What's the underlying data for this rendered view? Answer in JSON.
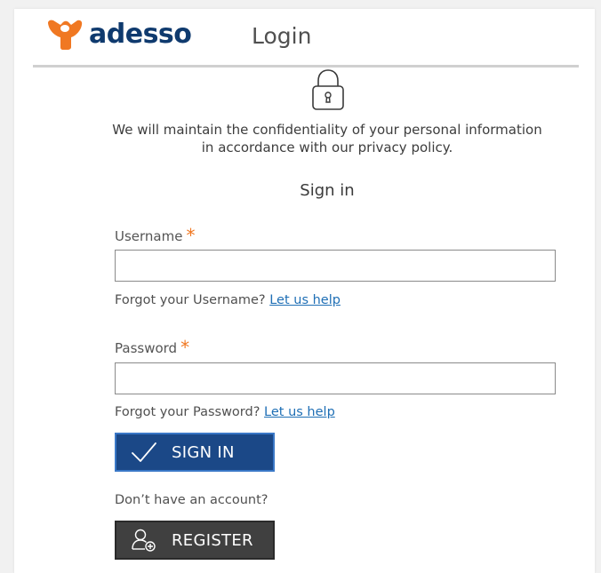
{
  "header": {
    "brand": "adesso",
    "title": "Login"
  },
  "icons": {
    "logo": "adesso-logo-icon",
    "lock": "lock-icon",
    "signin": "checkmark-icon",
    "register": "user-add-icon"
  },
  "privacy_notice": "We will maintain the confidentiality of your personal information in accordance with our privacy policy.",
  "form": {
    "heading": "Sign in",
    "username": {
      "label": "Username",
      "required_mark": "*",
      "value": "",
      "placeholder": ""
    },
    "username_help": {
      "text": "Forgot your Username?",
      "link": "Let us help"
    },
    "password": {
      "label": "Password",
      "required_mark": "*",
      "value": "",
      "placeholder": ""
    },
    "password_help": {
      "text": "Forgot your Password?",
      "link": "Let us help"
    },
    "signin_label": "SIGN IN",
    "no_account_text": "Don’t have an account?",
    "register_label": "REGISTER"
  },
  "colors": {
    "brand_orange": "#f07822",
    "brand_navy": "#0f3a6e",
    "signin_button": "#1b4887",
    "register_button": "#404040",
    "link": "#1f6fb5",
    "required": "#f07822"
  }
}
